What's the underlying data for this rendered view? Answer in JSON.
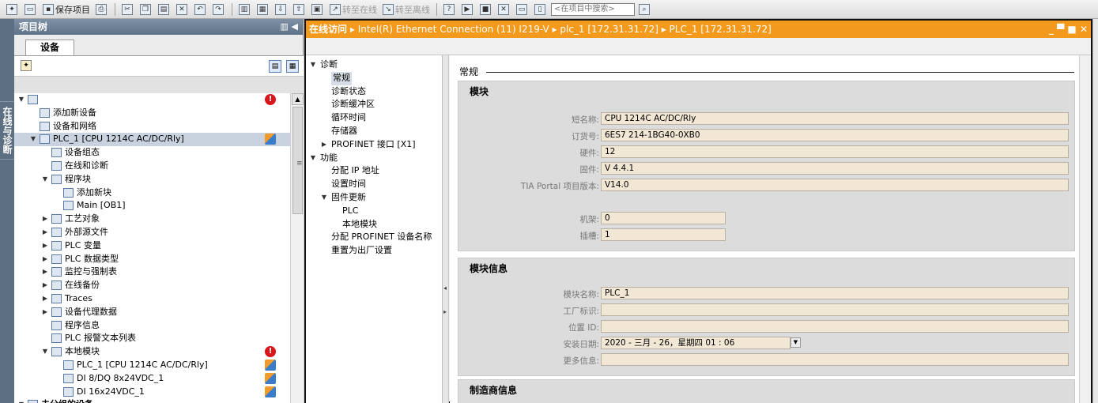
{
  "toolbar": {
    "save_label": "保存项目",
    "go_online_label": "转至在线",
    "go_offline_label": "转至离线",
    "search_placeholder": "<在项目中搜索>"
  },
  "side_tab": {
    "label": "在线与诊断"
  },
  "project_tree": {
    "title": "项目树",
    "devices_tab": "设备",
    "items": [
      {
        "label": "",
        "indent": 0,
        "arrow": "down",
        "status": "error"
      },
      {
        "label": "添加新设备",
        "indent": 1,
        "arrow": "",
        "status": ""
      },
      {
        "label": "设备和网络",
        "indent": 1,
        "arrow": "",
        "status": ""
      },
      {
        "label": "PLC_1 [CPU 1214C AC/DC/Rly]",
        "indent": 1,
        "arrow": "down",
        "status": "online",
        "selected": true
      },
      {
        "label": "设备组态",
        "indent": 2,
        "arrow": "",
        "status": ""
      },
      {
        "label": "在线和诊断",
        "indent": 2,
        "arrow": "",
        "status": ""
      },
      {
        "label": "程序块",
        "indent": 2,
        "arrow": "down",
        "status": ""
      },
      {
        "label": "添加新块",
        "indent": 3,
        "arrow": "",
        "status": ""
      },
      {
        "label": "Main [OB1]",
        "indent": 3,
        "arrow": "",
        "status": ""
      },
      {
        "label": "工艺对象",
        "indent": 2,
        "arrow": "right",
        "status": ""
      },
      {
        "label": "外部源文件",
        "indent": 2,
        "arrow": "right",
        "status": ""
      },
      {
        "label": "PLC 变量",
        "indent": 2,
        "arrow": "right",
        "status": ""
      },
      {
        "label": "PLC 数据类型",
        "indent": 2,
        "arrow": "right",
        "status": ""
      },
      {
        "label": "监控与强制表",
        "indent": 2,
        "arrow": "right",
        "status": ""
      },
      {
        "label": "在线备份",
        "indent": 2,
        "arrow": "right",
        "status": ""
      },
      {
        "label": "Traces",
        "indent": 2,
        "arrow": "right",
        "status": ""
      },
      {
        "label": "设备代理数据",
        "indent": 2,
        "arrow": "right",
        "status": ""
      },
      {
        "label": "程序信息",
        "indent": 2,
        "arrow": "",
        "status": ""
      },
      {
        "label": "PLC 报警文本列表",
        "indent": 2,
        "arrow": "",
        "status": ""
      },
      {
        "label": "本地模块",
        "indent": 2,
        "arrow": "down",
        "status": "error"
      },
      {
        "label": "PLC_1 [CPU 1214C AC/DC/Rly]",
        "indent": 3,
        "arrow": "",
        "status": "online"
      },
      {
        "label": "DI 8/DQ 8x24VDC_1",
        "indent": 3,
        "arrow": "",
        "status": "online"
      },
      {
        "label": "DI 16x24VDC_1",
        "indent": 3,
        "arrow": "",
        "status": "online"
      },
      {
        "label": "未分组的设备",
        "indent": 0,
        "arrow": "down",
        "status": "",
        "bold": true
      }
    ]
  },
  "editor": {
    "header_online": "在线访问",
    "header_path": "Intel(R) Ethernet Connection (11) I219-V  ▸  plc_1 [172.31.31.72]  ▸  PLC_1 [172.31.31.72]",
    "window_buttons": "_ ▀ ■ ✕"
  },
  "nav": {
    "items": [
      {
        "label": "诊断",
        "indent": 0,
        "arrow": "down"
      },
      {
        "label": "常规",
        "indent": 1,
        "arrow": "",
        "selected": true
      },
      {
        "label": "诊断状态",
        "indent": 1,
        "arrow": ""
      },
      {
        "label": "诊断缓冲区",
        "indent": 1,
        "arrow": ""
      },
      {
        "label": "循环时间",
        "indent": 1,
        "arrow": ""
      },
      {
        "label": "存储器",
        "indent": 1,
        "arrow": ""
      },
      {
        "label": "PROFINET 接口 [X1]",
        "indent": 1,
        "arrow": "right"
      },
      {
        "label": "功能",
        "indent": 0,
        "arrow": "down"
      },
      {
        "label": "分配 IP 地址",
        "indent": 1,
        "arrow": ""
      },
      {
        "label": "设置时间",
        "indent": 1,
        "arrow": ""
      },
      {
        "label": "固件更新",
        "indent": 1,
        "arrow": "down"
      },
      {
        "label": "PLC",
        "indent": 2,
        "arrow": ""
      },
      {
        "label": "本地模块",
        "indent": 2,
        "arrow": ""
      },
      {
        "label": "分配 PROFINET 设备名称",
        "indent": 1,
        "arrow": ""
      },
      {
        "label": "重置为出厂设置",
        "indent": 1,
        "arrow": ""
      }
    ]
  },
  "content": {
    "section_title": "常规",
    "module_panel": {
      "title": "模块",
      "fields": [
        {
          "label": "短名称:",
          "value": "CPU 1214C AC/DC/Rly",
          "width": "wide"
        },
        {
          "label": "订货号:",
          "value": "6ES7 214-1BG40-0XB0",
          "width": "wide"
        },
        {
          "label": "硬件:",
          "value": "12",
          "width": "wide"
        },
        {
          "label": "固件:",
          "value": "V 4.4.1",
          "width": "wide"
        },
        {
          "label": "TIA Portal 项目版本:",
          "value": "V14.0",
          "width": "wide"
        },
        {
          "label": "机架:",
          "value": "0",
          "width": "short"
        },
        {
          "label": "插槽:",
          "value": "1",
          "width": "short"
        }
      ]
    },
    "module_info_panel": {
      "title": "模块信息",
      "fields": [
        {
          "label": "模块名称:",
          "value": "PLC_1"
        },
        {
          "label": "工厂标识:",
          "value": ""
        },
        {
          "label": "位置 ID:",
          "value": ""
        },
        {
          "label": "安装日期:",
          "value": "2020 - 三月 - 26，星期四   01 : 06"
        },
        {
          "label": "更多信息:",
          "value": ""
        }
      ]
    },
    "manufacturer_panel": {
      "title": "制造商信息"
    }
  }
}
